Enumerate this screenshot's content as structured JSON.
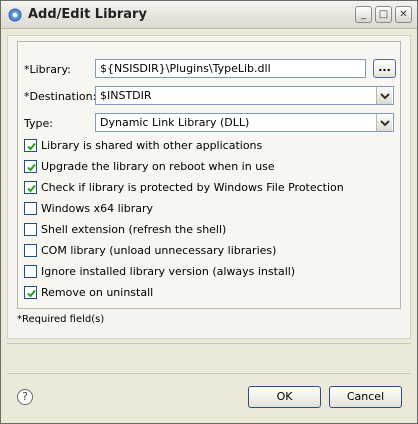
{
  "window": {
    "title": "Add/Edit Library"
  },
  "form": {
    "library_label": "*Library:",
    "library_value": "${NSISDIR}\\Plugins\\TypeLib.dll",
    "browse_label": "...",
    "destination_label": "*Destination:",
    "destination_value": "$INSTDIR",
    "type_label": "Type:",
    "type_value": "Dynamic Link Library (DLL)",
    "checkboxes": [
      {
        "label": "Library is shared with other applications",
        "checked": true
      },
      {
        "label": "Upgrade the library on reboot when in use",
        "checked": true
      },
      {
        "label": "Check if library is protected by Windows File Protection",
        "checked": true
      },
      {
        "label": "Windows x64 library",
        "checked": false
      },
      {
        "label": "Shell extension (refresh the shell)",
        "checked": false
      },
      {
        "label": "COM library (unload unnecessary libraries)",
        "checked": false
      },
      {
        "label": "Ignore installed library version (always install)",
        "checked": false
      },
      {
        "label": "Remove on uninstall",
        "checked": true
      }
    ],
    "required_note": "*Required field(s)"
  },
  "buttons": {
    "ok": "OK",
    "cancel": "Cancel",
    "help": "?"
  }
}
